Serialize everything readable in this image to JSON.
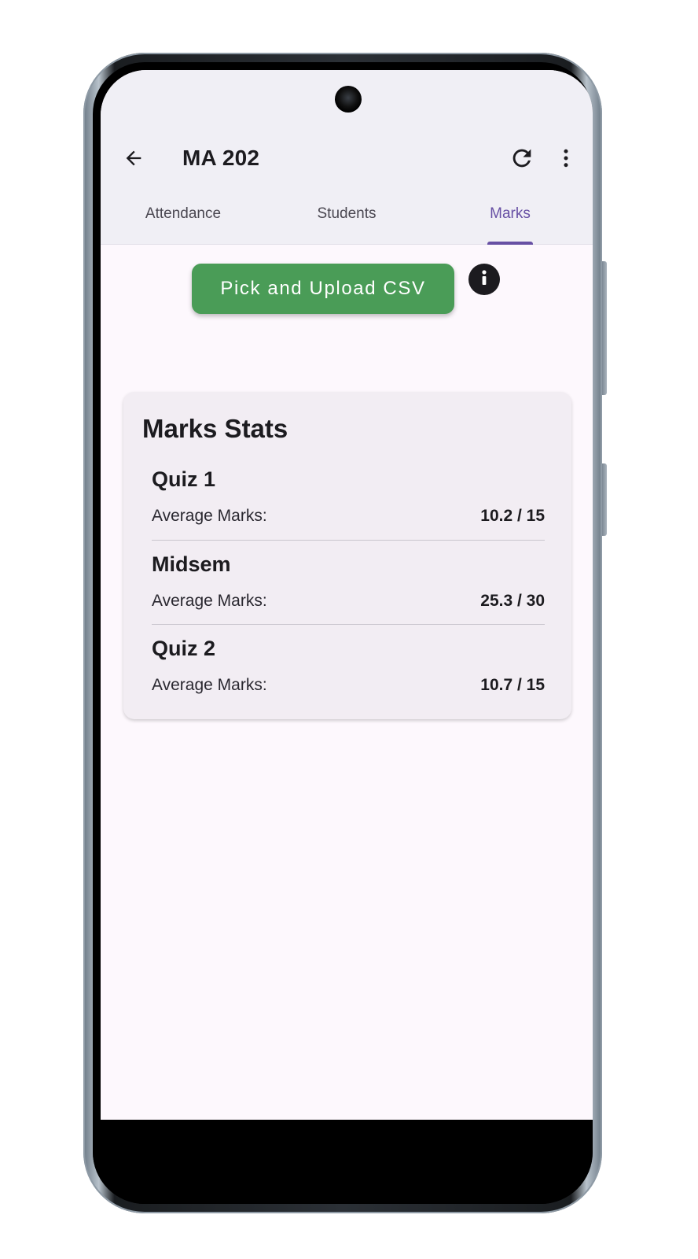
{
  "appbar": {
    "title": "MA 202",
    "back_icon": "arrow-back-icon",
    "refresh_icon": "refresh-icon",
    "more_icon": "more-vert-icon"
  },
  "tabs": [
    {
      "label": "Attendance",
      "active": false
    },
    {
      "label": "Students",
      "active": false
    },
    {
      "label": "Marks",
      "active": true
    }
  ],
  "actions": {
    "upload_label": "Pick and Upload CSV",
    "info_icon": "info-icon"
  },
  "stats": {
    "title": "Marks Stats",
    "exams": [
      {
        "name": "Quiz 1",
        "label": "Average Marks:",
        "value": "10.2 / 15"
      },
      {
        "name": "Midsem",
        "label": "Average Marks:",
        "value": "25.3 / 30"
      },
      {
        "name": "Quiz 2",
        "label": "Average Marks:",
        "value": "10.7 / 15"
      }
    ]
  },
  "colors": {
    "accent": "#6750a4",
    "upload_button": "#4a9c57",
    "appbar_bg": "#f0eff5",
    "card_bg": "#f2edf3"
  }
}
